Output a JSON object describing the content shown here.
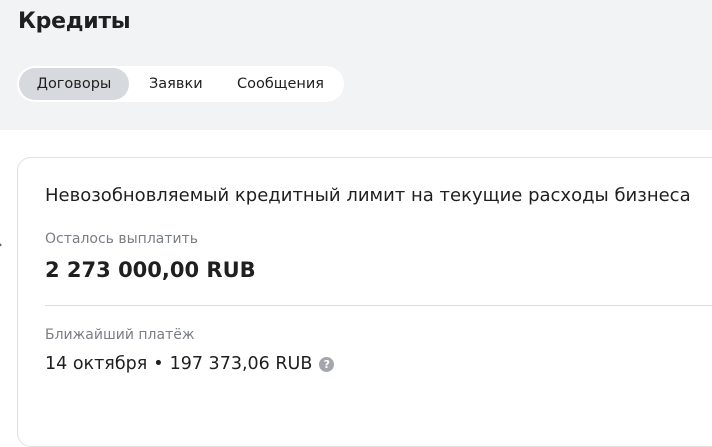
{
  "header": {
    "title": "Кредиты"
  },
  "tabs": [
    {
      "label": "Договоры",
      "active": true
    },
    {
      "label": "Заявки",
      "active": false
    },
    {
      "label": "Сообщения",
      "active": false
    }
  ],
  "card": {
    "title": "Невозобновляемый кредитный лимит на текущие расходы бизнеса",
    "remaining_label": "Осталось выплатить",
    "remaining_value": "2 273 000,00 RUB",
    "next_payment_label": "Ближайший платёж",
    "next_payment_date": "14 октября",
    "separator": "•",
    "next_payment_amount": "197 373,06 RUB",
    "help_icon_glyph": "?"
  },
  "icons": {
    "side_arrow": "chevron-right-icon",
    "help": "question-circle-icon"
  },
  "colors": {
    "top_background": "#f2f3f5",
    "active_tab": "#d6d9de",
    "muted_text": "#7a7e85",
    "help_icon": "#a3a7ad"
  }
}
